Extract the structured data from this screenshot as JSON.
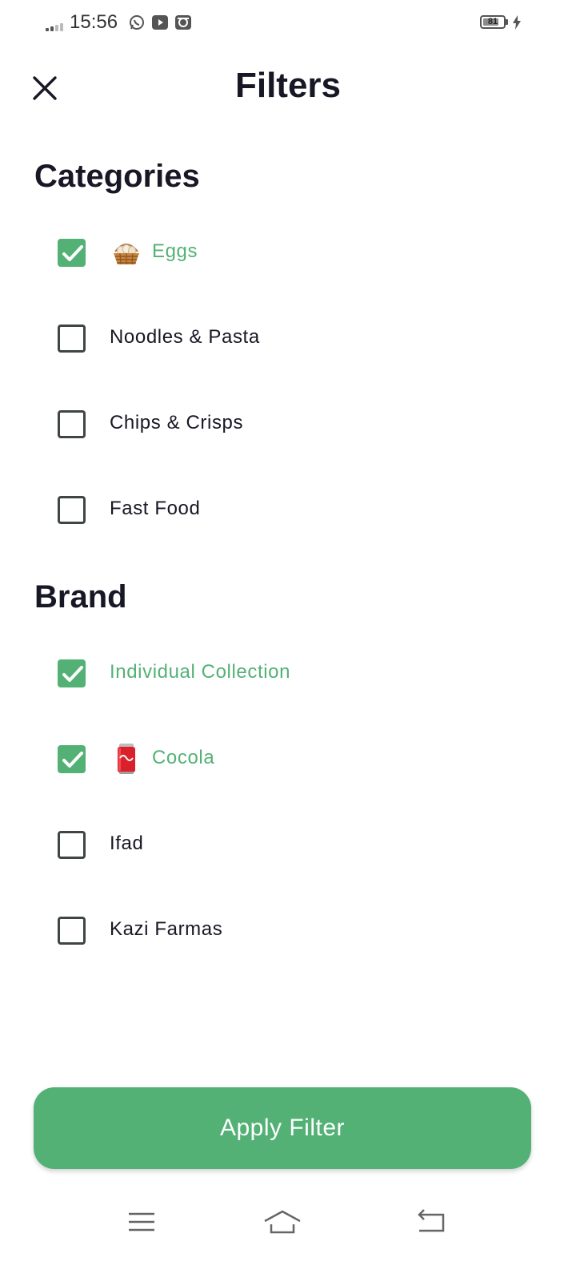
{
  "status_bar": {
    "time": "15:56",
    "battery_level": "81",
    "battery_fraction": 0.81,
    "notification_icons": [
      "whatsapp-icon",
      "youtube-icon",
      "instagram-icon"
    ],
    "charging": true
  },
  "header": {
    "title": "Filters",
    "close_icon": "close-icon"
  },
  "categories": {
    "title": "Categories",
    "items": [
      {
        "label": "Eggs",
        "checked": true,
        "thumbnail": "eggs-basket"
      },
      {
        "label": "Noodles & Pasta",
        "checked": false
      },
      {
        "label": "Chips & Crisps",
        "checked": false
      },
      {
        "label": "Fast Food",
        "checked": false
      }
    ]
  },
  "brand": {
    "title": "Brand",
    "items": [
      {
        "label": "Individual Collection",
        "checked": true
      },
      {
        "label": "Cocola",
        "checked": true,
        "thumbnail": "cola-can"
      },
      {
        "label": "Ifad",
        "checked": false
      },
      {
        "label": "Kazi Farmas",
        "checked": false
      }
    ]
  },
  "apply_button": {
    "label": "Apply Filter"
  },
  "colors": {
    "accent": "#53B175",
    "text": "#181725",
    "checkbox_border": "#3F4542"
  },
  "nav_bar": {
    "icons": [
      "menu-icon",
      "home-icon",
      "back-icon"
    ]
  }
}
